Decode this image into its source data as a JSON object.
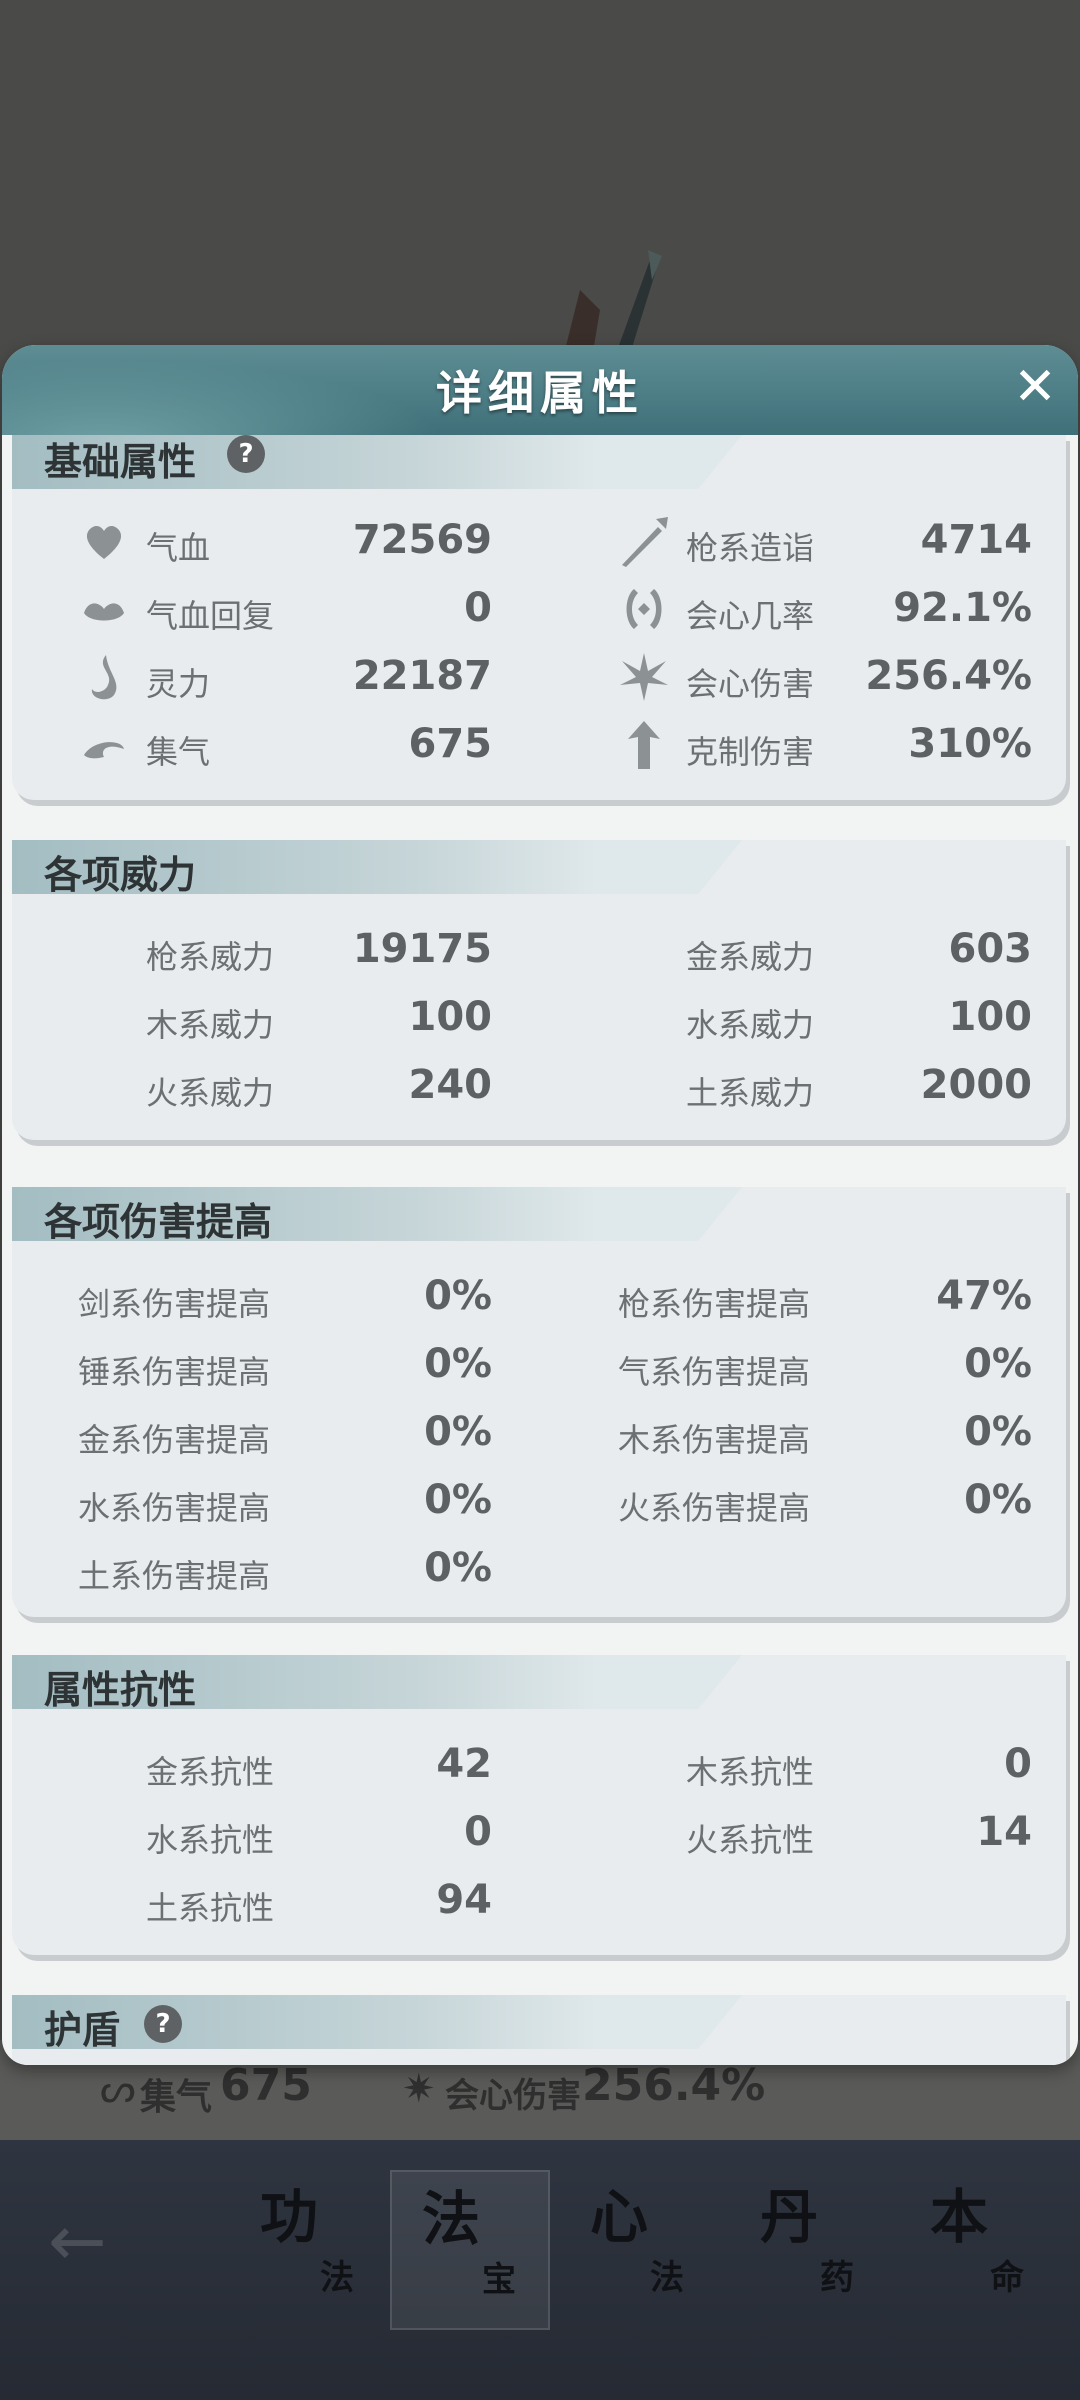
{
  "dialog": {
    "title": "详细属性",
    "close_icon": "close-icon"
  },
  "sections": {
    "basic": {
      "title": "基础属性",
      "help": "?",
      "left": [
        {
          "icon": "heart-icon",
          "label": "气血",
          "value": "72569"
        },
        {
          "icon": "heal-icon",
          "label": "气血回复",
          "value": "0"
        },
        {
          "icon": "spirit-flame-icon",
          "label": "灵力",
          "value": "22187"
        },
        {
          "icon": "qi-swirl-icon",
          "label": "集气",
          "value": "675"
        }
      ],
      "right": [
        {
          "icon": "spear-icon",
          "label": "枪系造诣",
          "value": "4714"
        },
        {
          "icon": "crit-chance-icon",
          "label": "会心几率",
          "value": "92.1%"
        },
        {
          "icon": "crit-damage-icon",
          "label": "会心伤害",
          "value": "256.4%"
        },
        {
          "icon": "counter-icon",
          "label": "克制伤害",
          "value": "310%"
        }
      ]
    },
    "power": {
      "title": "各项威力",
      "left": [
        {
          "label": "枪系威力",
          "value": "19175"
        },
        {
          "label": "木系威力",
          "value": "100"
        },
        {
          "label": "火系威力",
          "value": "240"
        }
      ],
      "right": [
        {
          "label": "金系威力",
          "value": "603"
        },
        {
          "label": "水系威力",
          "value": "100"
        },
        {
          "label": "土系威力",
          "value": "2000"
        }
      ]
    },
    "damage": {
      "title": "各项伤害提高",
      "left": [
        {
          "label": "剑系伤害提高",
          "value": "0%"
        },
        {
          "label": "锤系伤害提高",
          "value": "0%"
        },
        {
          "label": "金系伤害提高",
          "value": "0%"
        },
        {
          "label": "水系伤害提高",
          "value": "0%"
        },
        {
          "label": "土系伤害提高",
          "value": "0%"
        }
      ],
      "right": [
        {
          "label": "枪系伤害提高",
          "value": "47%"
        },
        {
          "label": "气系伤害提高",
          "value": "0%"
        },
        {
          "label": "木系伤害提高",
          "value": "0%"
        },
        {
          "label": "火系伤害提高",
          "value": "0%"
        }
      ]
    },
    "resist": {
      "title": "属性抗性",
      "left": [
        {
          "label": "金系抗性",
          "value": "42"
        },
        {
          "label": "水系抗性",
          "value": "0"
        },
        {
          "label": "土系抗性",
          "value": "94"
        }
      ],
      "right": [
        {
          "label": "木系抗性",
          "value": "0"
        },
        {
          "label": "火系抗性",
          "value": "14"
        }
      ]
    },
    "shield": {
      "title": "护盾",
      "help": "?"
    }
  },
  "background": {
    "stat_left_label": "集气",
    "stat_left_value": "675",
    "stat_right_label": "会心伤害",
    "stat_right_value": "256.4%"
  },
  "bottom_nav": {
    "back_icon": "back-arrow-icon",
    "items": [
      {
        "big": "功",
        "small": "法"
      },
      {
        "big": "法",
        "small": "宝",
        "active": true
      },
      {
        "big": "心",
        "small": "法"
      },
      {
        "big": "丹",
        "small": "药"
      },
      {
        "big": "本",
        "small": "命"
      }
    ]
  }
}
